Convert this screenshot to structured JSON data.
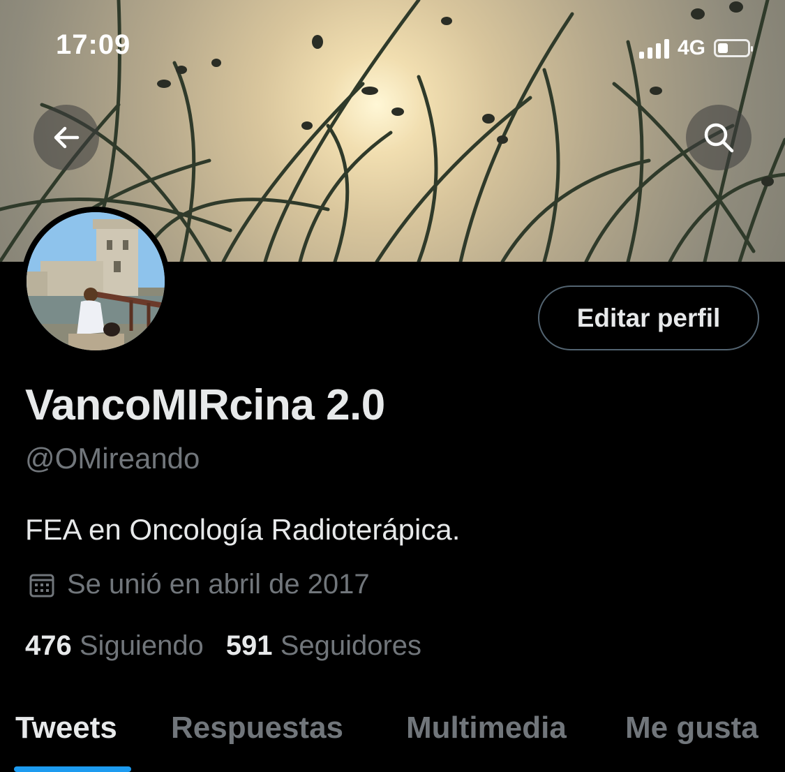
{
  "status_bar": {
    "time": "17:09",
    "network": "4G",
    "battery_fraction": 0.35
  },
  "header": {
    "back_icon": "arrow-left-icon",
    "search_icon": "search-icon"
  },
  "profile": {
    "edit_button_label": "Editar perfil",
    "display_name": "VancoMIRcina 2.0",
    "handle": "@OMireando",
    "bio": "FEA en Oncología Radioterápica.",
    "joined_icon": "calendar-icon",
    "joined_text": "Se unió en abril de 2017",
    "following_count": "476",
    "following_label": "Siguiendo",
    "followers_count": "591",
    "followers_label": "Seguidores"
  },
  "tabs": [
    {
      "label": "Tweets",
      "active": true
    },
    {
      "label": "Respuestas",
      "active": false
    },
    {
      "label": "Multimedia",
      "active": false
    },
    {
      "label": "Me gusta",
      "active": false
    }
  ],
  "colors": {
    "background": "#000000",
    "primary_text": "#e7e9ea",
    "secondary_text": "#71767b",
    "accent": "#1d9bf0"
  }
}
